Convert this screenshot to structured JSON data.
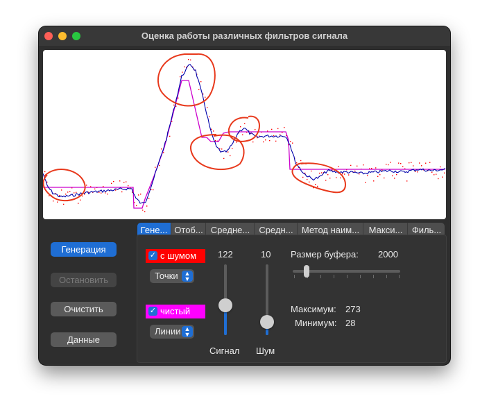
{
  "window": {
    "title": "Оценка работы различных фильтров сигнала"
  },
  "buttons": {
    "generate": "Генерация",
    "stop": "Остановить",
    "clear": "Очистить",
    "data": "Данные"
  },
  "tabs": [
    "Гене...",
    "Отоб...",
    "Средне...",
    "Средн...",
    "Метод наим...",
    "Макси...",
    "Филь..."
  ],
  "active_tab": 0,
  "panel": {
    "noisy": {
      "label": "с шумом",
      "checked": true,
      "color": "#ff0000",
      "display_mode": "Точки"
    },
    "clean": {
      "label": "чистый",
      "checked": true,
      "color": "#ff00ff",
      "display_mode": "Линии"
    },
    "signal_slider": {
      "value": "122",
      "label": "Сигнал"
    },
    "noise_slider": {
      "value": "10",
      "label": "Шум"
    },
    "buffer": {
      "label": "Размер буфера:",
      "value": "2000"
    },
    "max": {
      "label": "Максимум:",
      "value": "273"
    },
    "min": {
      "label": "Минимум:",
      "value": "28"
    }
  },
  "colors": {
    "accent": "#1f6ed4",
    "filtered_line": "#0000aa",
    "clean_line": "#cc00cc",
    "noise_dots": "#ff0000",
    "annotation": "#e8391c"
  }
}
